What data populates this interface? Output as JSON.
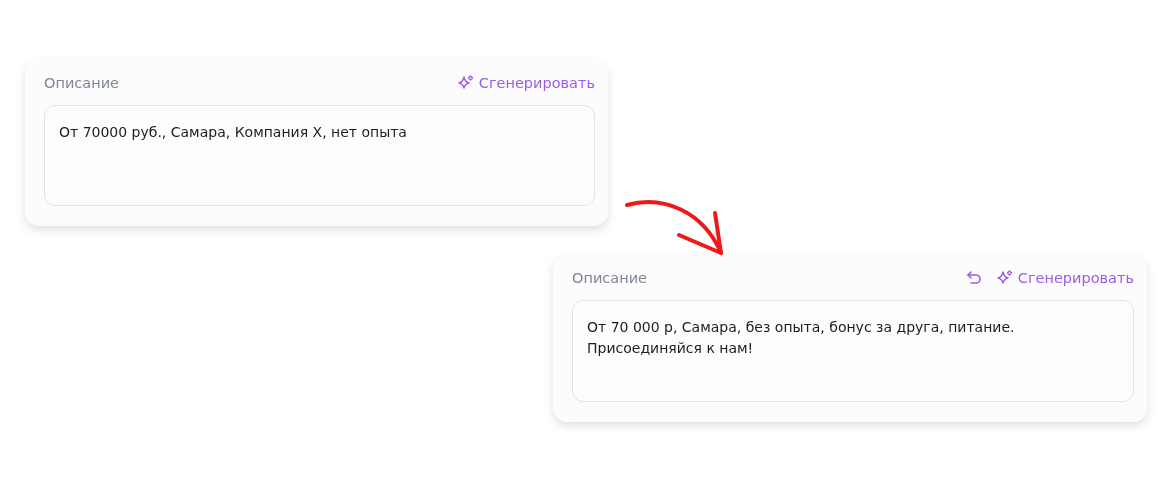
{
  "cards": [
    {
      "label": "Описание",
      "actions": [
        {
          "kind": "generate",
          "label": "Сгенерировать"
        }
      ],
      "value": "От 70000 руб., Самара, Компания Х, нет опыта"
    },
    {
      "label": "Описание",
      "actions": [
        {
          "kind": "undo"
        },
        {
          "kind": "generate",
          "label": "Сгенерировать"
        }
      ],
      "value": "От 70 000 р, Самара, без опыта, бонус за друга, питание. Присоединяйся к нам!"
    }
  ]
}
